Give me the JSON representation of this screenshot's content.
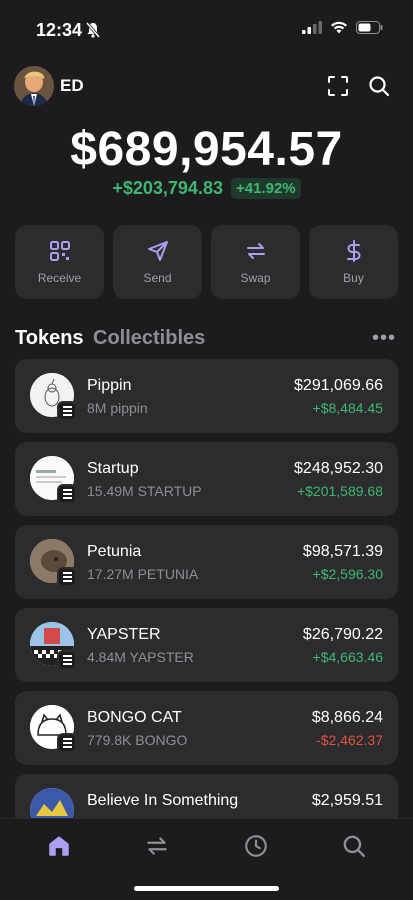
{
  "status": {
    "time": "12:34"
  },
  "account": {
    "name": "ED"
  },
  "wallet": {
    "balance": "$689,954.57",
    "change_amount": "+$203,794.83",
    "change_percent": "+41.92%"
  },
  "actions": [
    {
      "label": "Receive",
      "icon": "qr-icon"
    },
    {
      "label": "Send",
      "icon": "send-icon"
    },
    {
      "label": "Swap",
      "icon": "swap-icon"
    },
    {
      "label": "Buy",
      "icon": "dollar-icon"
    }
  ],
  "tabs": {
    "tokens": "Tokens",
    "collectibles": "Collectibles"
  },
  "tokens": [
    {
      "name": "Pippin",
      "amount": "8M pippin",
      "value": "$291,069.66",
      "change": "+$8,484.45",
      "direction": "up"
    },
    {
      "name": "Startup",
      "amount": "15.49M STARTUP",
      "value": "$248,952.30",
      "change": "+$201,589.68",
      "direction": "up"
    },
    {
      "name": "Petunia",
      "amount": "17.27M PETUNIA",
      "value": "$98,571.39",
      "change": "+$2,596.30",
      "direction": "up"
    },
    {
      "name": "YAPSTER",
      "amount": "4.84M YAPSTER",
      "value": "$26,790.22",
      "change": "+$4,663.46",
      "direction": "up"
    },
    {
      "name": "BONGO CAT",
      "amount": "779.8K BONGO",
      "value": "$8,866.24",
      "change": "-$2,462.37",
      "direction": "down"
    },
    {
      "name": "Believe In Something",
      "amount": "",
      "value": "$2,959.51",
      "change": "",
      "direction": "up"
    }
  ],
  "colors": {
    "accent": "#ab9ff2",
    "positive": "#3fb772",
    "negative": "#e0533f",
    "card": "#2c2c2e",
    "background": "#1c1c1e"
  },
  "nav": [
    "home-icon",
    "swap-icon",
    "clock-icon",
    "search-icon"
  ]
}
